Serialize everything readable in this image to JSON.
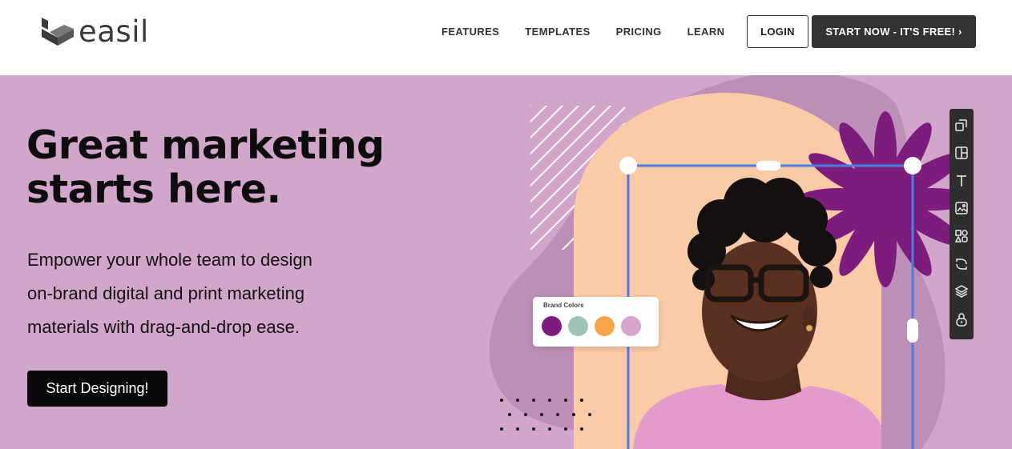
{
  "header": {
    "logo_text": "easil",
    "nav": [
      "FEATURES",
      "TEMPLATES",
      "PRICING",
      "LEARN"
    ],
    "login_label": "LOGIN",
    "start_label": "START NOW - IT'S FREE! ›"
  },
  "hero": {
    "headline_line1": "Great marketing",
    "headline_line2": "starts here.",
    "sub_line1": "Empower your whole team to design",
    "sub_line2": "on-brand digital and print marketing",
    "sub_line3": "materials with drag-and-drop ease.",
    "cta_label": "Start Designing!"
  },
  "brand_colors": {
    "title": "Brand Colors",
    "swatches": [
      "#7e1c7e",
      "#9dc4b5",
      "#f6a648",
      "#d8a6cc"
    ]
  },
  "toolbar": {
    "icons": [
      "resize-icon",
      "layout-icon",
      "text-icon",
      "image-icon",
      "shapes-icon",
      "background-icon",
      "layers-icon",
      "lock-icon"
    ]
  },
  "colors": {
    "hero_bg": "#d2a5cb",
    "accent_purple": "#7e1c7e",
    "peach": "#fbcaa6",
    "selection_blue": "#4a7de8"
  }
}
